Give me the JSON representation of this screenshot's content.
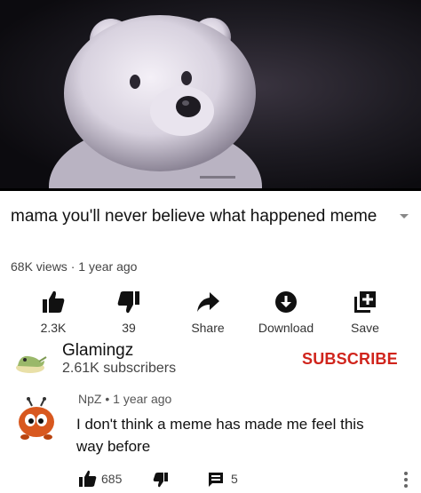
{
  "video": {
    "title": "mama you'll never believe what happened meme",
    "views": "68K views",
    "age": "1 year ago"
  },
  "actions": [
    {
      "label": "2.3K",
      "icon": "thumbs-up-icon"
    },
    {
      "label": "39",
      "icon": "thumbs-down-icon"
    },
    {
      "label": "Share",
      "icon": "share-icon"
    },
    {
      "label": "Download",
      "icon": "download-icon"
    },
    {
      "label": "Save",
      "icon": "save-to-playlist-icon"
    }
  ],
  "channel": {
    "name": "Glamingz",
    "subscribers": "2.61K subscribers",
    "subscribe_label": "SUBSCRIBE"
  },
  "comment": {
    "author": "NpZ",
    "age": "1 year ago",
    "text": "I don't think a meme has made me feel this way before",
    "likes": "685",
    "replies": "5"
  },
  "colors": {
    "subscribe": "#d0241c",
    "icon": "#111111",
    "meta_text": "#444444"
  }
}
